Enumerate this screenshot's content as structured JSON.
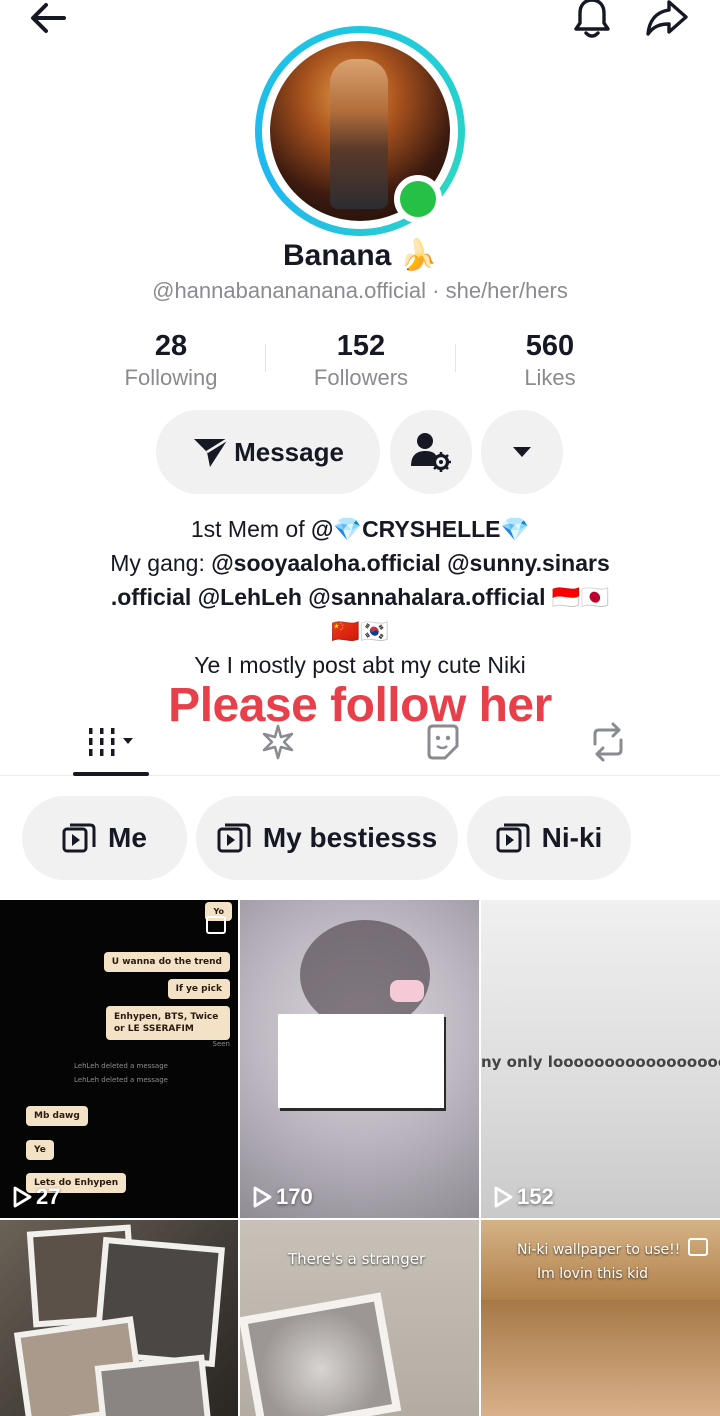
{
  "header": {
    "back": "arrow-left-icon",
    "bell": "bell-icon",
    "share": "share-icon"
  },
  "profile": {
    "name": "Banana 🍌",
    "handle": "@hannabanananana.official · she/her/hers"
  },
  "stats": [
    {
      "value": "28",
      "label": "Following"
    },
    {
      "value": "152",
      "label": "Followers"
    },
    {
      "value": "560",
      "label": "Likes"
    }
  ],
  "actions": {
    "message_label": "Message"
  },
  "bio": {
    "line1_prefix": "1st Mem of ",
    "line1_mention": "@💎CRYSHELLE💎",
    "line2_prefix": "My gang: ",
    "line2_mentions": "@sooyaaloha.official @sunny.sinars",
    "line3_mentions": ".official @LehLeh @sannahalara.official",
    "line3_flags": " 🇮🇩🇯🇵",
    "line4": "🇨🇳🇰🇷",
    "line5": "Ye I mostly post abt my cute Niki"
  },
  "overlay_text": "Please follow her",
  "playlists": [
    {
      "label": "Me"
    },
    {
      "label": "My bestiesss"
    },
    {
      "label": "Ni-ki"
    }
  ],
  "videos": [
    {
      "views": "27"
    },
    {
      "views": "170"
    },
    {
      "views": "152"
    },
    {
      "views": ""
    },
    {
      "views": ""
    },
    {
      "views": ""
    }
  ],
  "tile1_chat": {
    "b1": "Yo",
    "b2": "U wanna do the trend",
    "b3": "If ye pick",
    "b4": "Enhypen, BTS, Twice or LE SSERAFIM",
    "seen": "Seen",
    "sys1": "LehLeh deleted a message",
    "sys2": "LehLeh deleted a message",
    "b5": "Mb dawg",
    "b6": "Ye",
    "b7": "Lets do Enhypen"
  },
  "tile3_caption": "ny only looooooooooooooooooo",
  "tile5_caption": "There's a stranger",
  "tile6_caption1": "Ni-ki wallpaper to use!!",
  "tile6_caption2": "Im lovin this kid"
}
